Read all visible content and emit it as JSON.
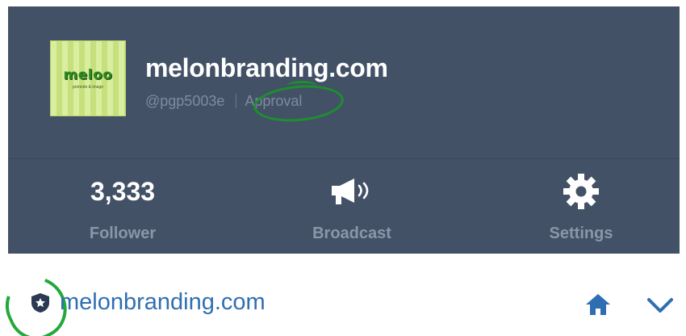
{
  "profile": {
    "logo_word": "meloo",
    "logo_tagline": "promote & image",
    "title": "melonbranding.com",
    "handle": "@pgp5003e",
    "status": "Approval"
  },
  "stats": [
    {
      "value": "3,333",
      "label": "Follower",
      "icon": ""
    },
    {
      "value": "",
      "label": "Broadcast",
      "icon": "megaphone-icon"
    },
    {
      "value": "",
      "label": "Settings",
      "icon": "gear-icon"
    }
  ],
  "bottom_bar": {
    "title": "melonbranding.com",
    "badge_icon": "shield-star-icon",
    "home_icon": "home-icon",
    "expand_icon": "chevron-down-icon"
  },
  "colors": {
    "panel": "#435166",
    "title_link": "#2f6fb1",
    "annotation": "#1c8f2e"
  }
}
